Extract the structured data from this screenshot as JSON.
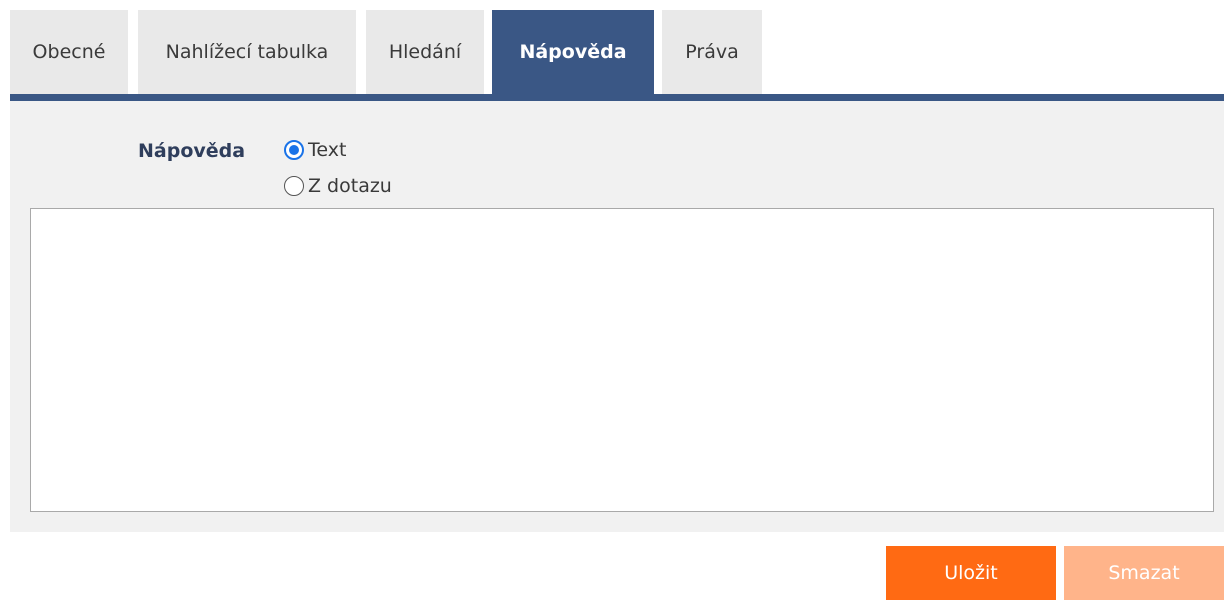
{
  "tabs": [
    {
      "label": "Obecné",
      "active": false
    },
    {
      "label": "Nahlížecí tabulka",
      "active": false
    },
    {
      "label": "Hledání",
      "active": false
    },
    {
      "label": "Nápověda",
      "active": true
    },
    {
      "label": "Práva",
      "active": false
    }
  ],
  "help_form": {
    "label": "Nápověda",
    "options": [
      {
        "label": "Text",
        "checked": true
      },
      {
        "label": "Z dotazu",
        "checked": false
      }
    ],
    "text_value": ""
  },
  "actions": {
    "save_label": "Uložit",
    "delete_label": "Smazat"
  },
  "colors": {
    "accent": "#3a5785",
    "save": "#ff6a13",
    "delete_disabled": "#ffb48a",
    "radio_checked": "#1a73e8"
  }
}
